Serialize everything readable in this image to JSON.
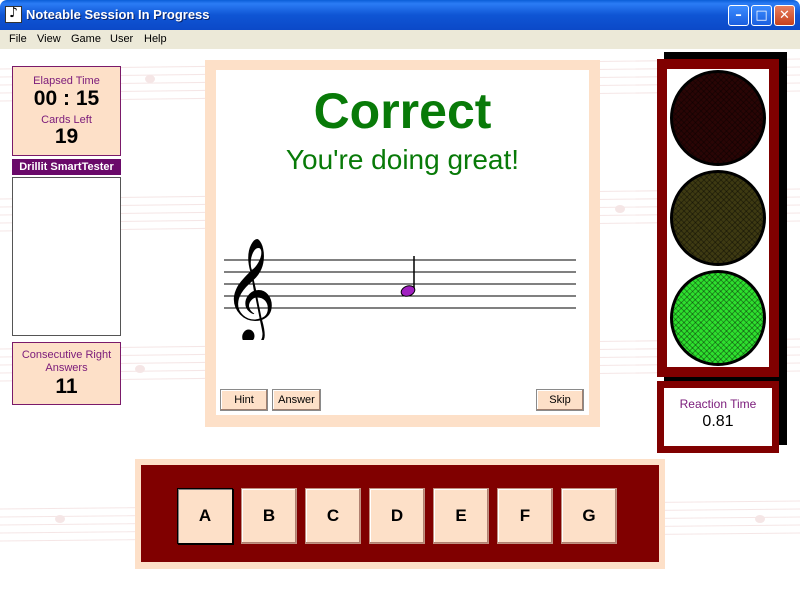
{
  "window": {
    "title": "Noteable Session In Progress",
    "minimize": "–",
    "maximize": "□",
    "close": "✕"
  },
  "menu": [
    "File",
    "View",
    "Game",
    "User",
    "Help"
  ],
  "stats": {
    "elapsed_label": "Elapsed Time",
    "elapsed_value": "00 : 15",
    "cards_label": "Cards Left",
    "cards_value": "19",
    "smart_title": "Drillit SmartTester",
    "consecutive_label": "Consecutive Right Answers",
    "consecutive_value": "11"
  },
  "card": {
    "result": "Correct",
    "message": "You're doing great!",
    "note_color": "#a020c0",
    "buttons": {
      "hint": "Hint",
      "answer": "Answer",
      "skip": "Skip"
    }
  },
  "traffic_light": {
    "red": "#2a0505",
    "yellow": "#3e3a12",
    "green": "#2ee02e",
    "active": "green"
  },
  "reaction": {
    "label": "Reaction Time",
    "value": "0.81"
  },
  "answers": {
    "keys": [
      "A",
      "B",
      "C",
      "D",
      "E",
      "F",
      "G"
    ],
    "pressed": "A"
  },
  "colors": {
    "panel": "#fde0c8",
    "frame": "#800000",
    "accent_text": "#7a1a7a",
    "result_green": "#087a08"
  }
}
